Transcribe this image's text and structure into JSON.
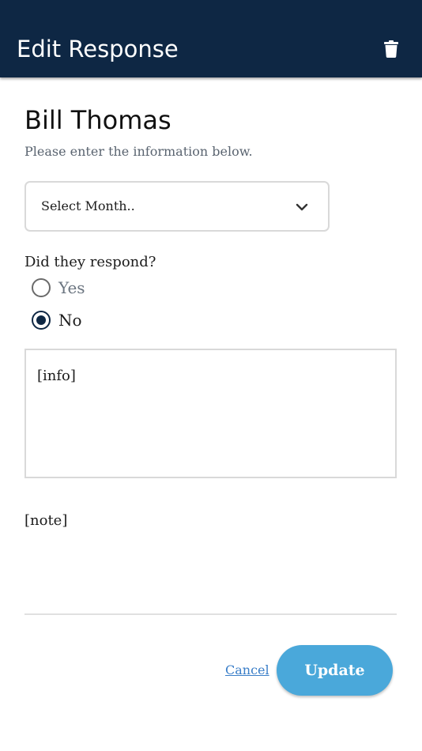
{
  "header": {
    "title": "Edit Response",
    "delete_icon": "trash-icon",
    "background_color": "#0e2744"
  },
  "form": {
    "person_name": "Bill Thomas",
    "instructions": "Please enter the information below.",
    "month_select": {
      "selected": "Select Month..",
      "icon": "chevron-down-icon"
    },
    "question": "Did they respond?",
    "options": [
      {
        "label": "Yes",
        "selected": false
      },
      {
        "label": "No",
        "selected": true
      }
    ],
    "info_value": "[info]",
    "note": "[note]"
  },
  "actions": {
    "cancel_label": "Cancel",
    "update_label": "Update",
    "update_color": "#4aa8da",
    "link_color": "#3a7ec8"
  }
}
